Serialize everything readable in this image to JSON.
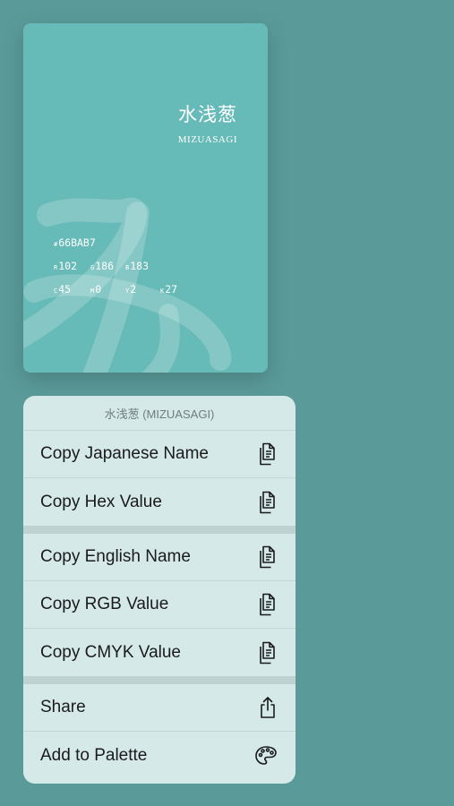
{
  "card": {
    "bg_color": "#66BAB7",
    "japanese_name": "水浅葱",
    "romaji": "MIZUASAGI",
    "hex": {
      "label": "#",
      "value": "66BAB7"
    },
    "rgb": [
      {
        "label": "R",
        "value": "102"
      },
      {
        "label": "G",
        "value": "186"
      },
      {
        "label": "B",
        "value": "183"
      }
    ],
    "cmyk": [
      {
        "label": "C",
        "value": "45"
      },
      {
        "label": "M",
        "value": "0"
      },
      {
        "label": "Y",
        "value": "2"
      },
      {
        "label": "K",
        "value": "27"
      }
    ]
  },
  "menu": {
    "header": "水浅葱 (MIZUASAGI)",
    "items": [
      {
        "label": "Copy Japanese Name",
        "icon": "copy-icon"
      },
      {
        "label": "Copy Hex Value",
        "icon": "copy-icon"
      },
      {
        "label": "Copy English Name",
        "icon": "copy-icon"
      },
      {
        "label": "Copy RGB Value",
        "icon": "copy-icon"
      },
      {
        "label": "Copy CMYK Value",
        "icon": "copy-icon"
      },
      {
        "label": "Share",
        "icon": "share-icon"
      },
      {
        "label": "Add to Palette",
        "icon": "palette-icon"
      }
    ]
  }
}
